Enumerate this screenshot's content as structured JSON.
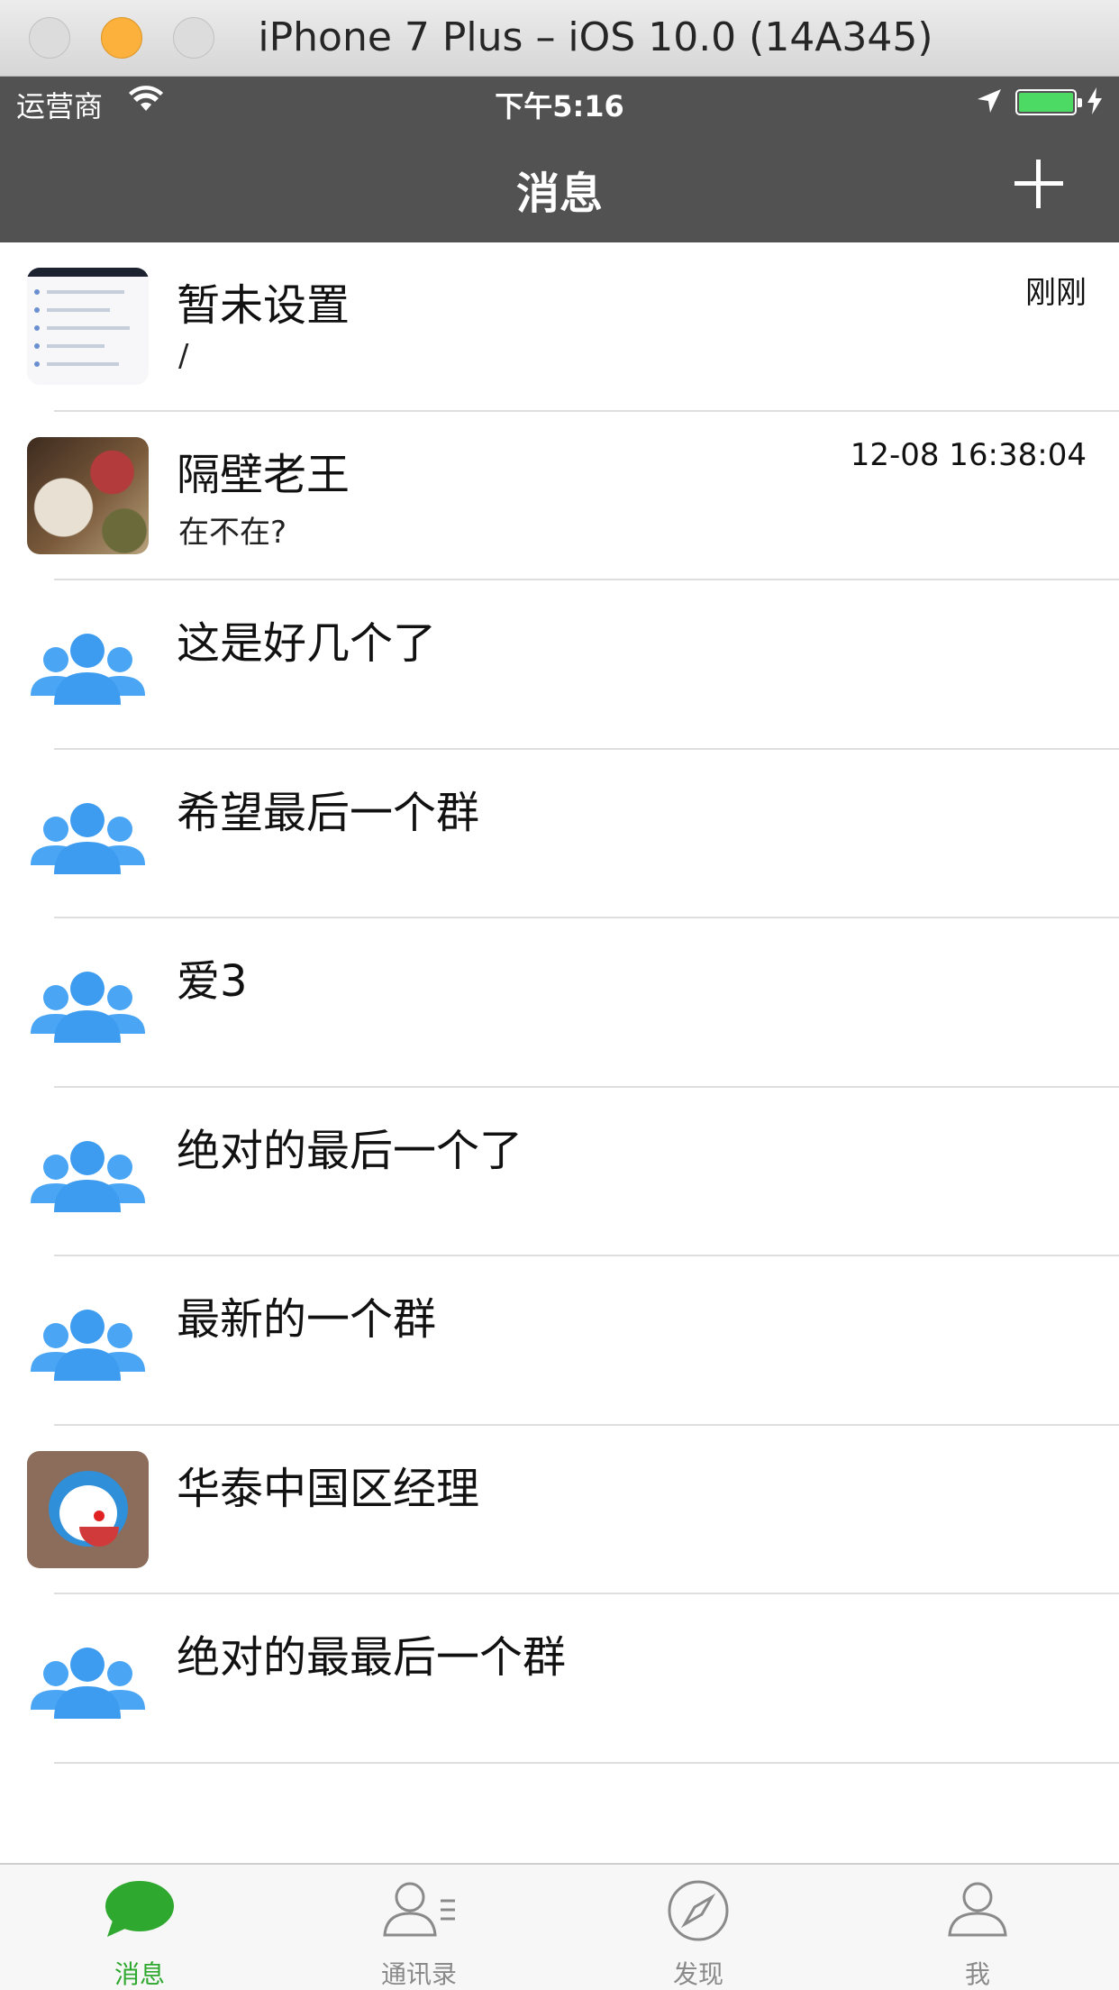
{
  "window": {
    "title": "iPhone 7 Plus – iOS 10.0 (14A345)"
  },
  "status_bar": {
    "carrier": "运营商",
    "time": "下午5:16",
    "battery_color": "#4cd964"
  },
  "nav": {
    "title": "消息"
  },
  "conversations": [
    {
      "title": "暂未设置",
      "subtitle": "/",
      "time": "刚刚",
      "avatar": "screenshot-thumbnail"
    },
    {
      "title": "隔壁老王",
      "subtitle": "在不在?",
      "time": "12-08 16:38:04",
      "avatar": "food-photo"
    },
    {
      "title": "这是好几个了",
      "subtitle": "",
      "time": "",
      "avatar": "group-icon"
    },
    {
      "title": "希望最后一个群",
      "subtitle": "",
      "time": "",
      "avatar": "group-icon"
    },
    {
      "title": "爱3",
      "subtitle": "",
      "time": "",
      "avatar": "group-icon"
    },
    {
      "title": "绝对的最后一个了",
      "subtitle": "",
      "time": "",
      "avatar": "group-icon"
    },
    {
      "title": "最新的一个群",
      "subtitle": "",
      "time": "",
      "avatar": "group-icon"
    },
    {
      "title": "华泰中国区经理",
      "subtitle": "",
      "time": "",
      "avatar": "doraemon-photo"
    },
    {
      "title": "绝对的最最后一个群",
      "subtitle": "",
      "time": "",
      "avatar": "group-icon"
    }
  ],
  "tabs": [
    {
      "label": "消息",
      "icon": "chat-bubble-icon",
      "active": true
    },
    {
      "label": "通讯录",
      "icon": "contacts-icon",
      "active": false
    },
    {
      "label": "发现",
      "icon": "compass-icon",
      "active": false
    },
    {
      "label": "我",
      "icon": "person-icon",
      "active": false
    }
  ],
  "colors": {
    "nav_background": "#525252",
    "tab_active": "#2ea82e",
    "tab_inactive": "#8a8a8a",
    "group_icon": "#4aa6f4"
  }
}
